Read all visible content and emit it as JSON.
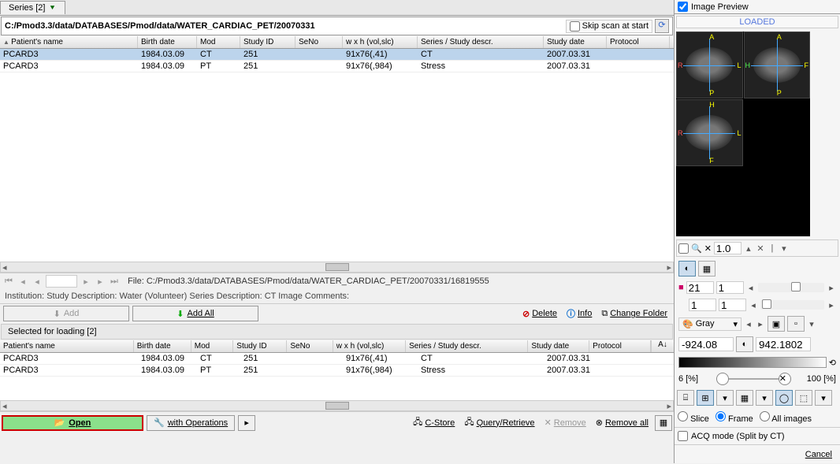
{
  "tabs": {
    "series_label": "Series [2]"
  },
  "path": "C:/Pmod3.3/data/DATABASES/Pmod/data/WATER_CARDIAC_PET/20070331",
  "skip_scan_label": "Skip scan at start",
  "columns": {
    "name": "Patient's name",
    "birth": "Birth date",
    "mod": "Mod",
    "studyid": "Study ID",
    "seno": "SeNo",
    "wxh": "w x h (vol,slc)",
    "series": "Series / Study descr.",
    "date": "Study date",
    "proto": "Protocol"
  },
  "rows": [
    {
      "name": "PCARD3",
      "birth": "1984.03.09",
      "mod": "CT",
      "studyid": "251",
      "seno": "",
      "wxh": "91x76(,41)",
      "series": "CT",
      "date": "2007.03.31",
      "proto": ""
    },
    {
      "name": "PCARD3",
      "birth": "1984.03.09",
      "mod": "PT",
      "studyid": "251",
      "seno": "",
      "wxh": "91x76(,984)",
      "series": "Stress",
      "date": "2007.03.31",
      "proto": ""
    }
  ],
  "file_label": "File: C:/Pmod3.3/data/DATABASES/Pmod/data/WATER_CARDIAC_PET/20070331/16819555",
  "info_line": "Institution:  Study Description: Water (Volunteer) Series Description: CT Image Comments:",
  "buttons": {
    "add": "Add",
    "add_all": "Add All",
    "delete": "Delete",
    "info": "Info",
    "change_folder": "Change Folder",
    "open": "Open",
    "with_ops": "with Operations",
    "cstore": "C-Store",
    "query": "Query/Retrieve",
    "remove": "Remove",
    "remove_all": "Remove all",
    "cancel": "Cancel"
  },
  "selected_title": "Selected for loading  [2]",
  "preview_title": "Image Preview",
  "loaded": "LOADED",
  "zoom_value": "1.0",
  "range1_a": "21",
  "range1_b": "1",
  "range2_a": "1",
  "range2_b": "1",
  "colormap": "Gray",
  "min_val": "-924.08",
  "max_val": "942.1802",
  "pct_min": "6",
  "pct_max": "100",
  "pct_unit": "[%]",
  "radios": {
    "slice": "Slice",
    "frame": "Frame",
    "all": "All images"
  },
  "acq_label": "ACQ mode (Split by CT)"
}
